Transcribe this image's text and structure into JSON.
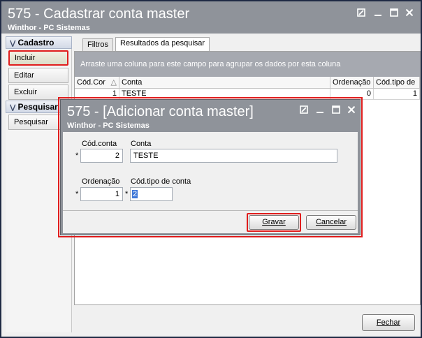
{
  "window": {
    "title": "575 - Cadastrar conta master",
    "subtitle": "Winthor - PC Sistemas"
  },
  "sidebar": {
    "section1": "Cadastro",
    "items": [
      "Incluir",
      "Editar",
      "Excluir"
    ],
    "section2": "Pesquisar",
    "search_item": "Pesquisar"
  },
  "tabs": [
    "Filtros",
    "Resultados da pesquisar"
  ],
  "grid": {
    "group_hint": "Arraste uma coluna para este campo para agrupar os dados por esta coluna",
    "columns": [
      "Cód.Cor",
      "Conta",
      "Ordenação",
      "Cód.tipo de"
    ],
    "rows": [
      [
        "1",
        "TESTE",
        "0",
        "1"
      ]
    ]
  },
  "footer": {
    "close_label": "Fechar"
  },
  "dialog": {
    "title": "575 - [Adicionar conta master]",
    "subtitle": "Winthor - PC Sistemas",
    "fields": {
      "cod_conta_label": "Cód.conta",
      "cod_conta_value": "2",
      "conta_label": "Conta",
      "conta_value": "TESTE",
      "ordenacao_label": "Ordenação",
      "ordenacao_value": "1",
      "cod_tipo_label": "Cód.tipo de conta",
      "cod_tipo_value": "2",
      "required_mark": "*"
    },
    "save_label": "Gravar",
    "cancel_label": "Cancelar"
  }
}
